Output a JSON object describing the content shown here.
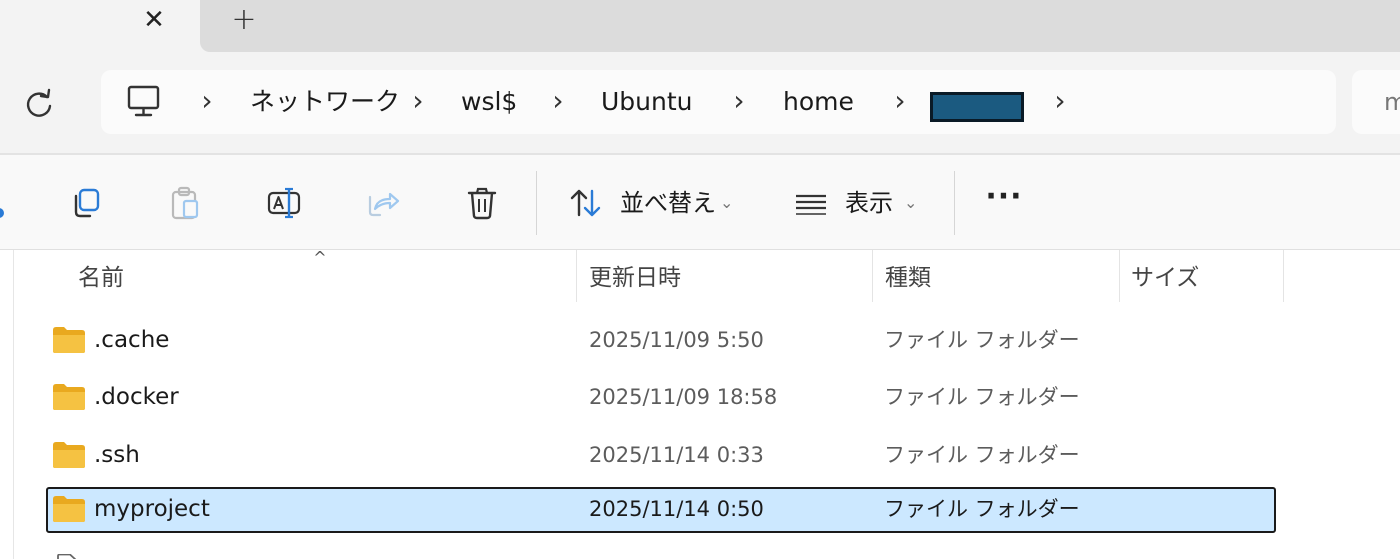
{
  "tabs": {
    "close_glyph": "✕",
    "new_tab_glyph": "+"
  },
  "address": {
    "crumbs": [
      "ネットワーク",
      "wsl$",
      "Ubuntu",
      "home"
    ],
    "separator": "›",
    "search_partial": "m"
  },
  "toolbar": {
    "sort_label": "並べ替え",
    "view_label": "表示",
    "chevron": "⌄",
    "more_label": "···"
  },
  "columns": {
    "name": "名前",
    "modified": "更新日時",
    "type": "種類",
    "size": "サイズ",
    "sort_indicator": "^"
  },
  "files": [
    {
      "name": ".cache",
      "modified": "2025/11/09 5:50",
      "type": "ファイル フォルダー",
      "selected": false
    },
    {
      "name": ".docker",
      "modified": "2025/11/09 18:58",
      "type": "ファイル フォルダー",
      "selected": false
    },
    {
      "name": ".ssh",
      "modified": "2025/11/14 0:33",
      "type": "ファイル フォルダー",
      "selected": false
    },
    {
      "name": "myproject",
      "modified": "2025/11/14 0:50",
      "type": "ファイル フォルダー",
      "selected": true
    }
  ],
  "icons": {
    "refresh": "refresh-icon",
    "pc": "this-pc-icon",
    "copy": "copy-icon",
    "paste": "paste-icon",
    "rename": "rename-icon",
    "share": "share-icon",
    "delete": "delete-icon",
    "sort": "sort-icon",
    "view": "view-icon",
    "folder": "folder-icon"
  },
  "colors": {
    "selection_bg": "#cce8ff",
    "folder_yellow": "#f5c242",
    "accent": "#2a7bd6",
    "redaction": "#1b5a80"
  }
}
